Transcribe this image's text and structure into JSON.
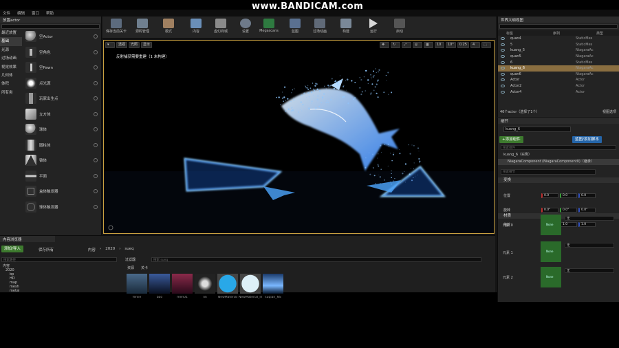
{
  "watermark": "www.BANDICAM.com",
  "menu": [
    "文件",
    "编辑",
    "窗口",
    "帮助"
  ],
  "place_panel": {
    "title": "放置actor",
    "categories": [
      "最近放置",
      "基础",
      "光源",
      "过场动画",
      "视觉效果",
      "几何体",
      "体积",
      "所有类"
    ],
    "selected_category": 1,
    "items": [
      "空Actor",
      "空角色",
      "空Pawn",
      "点光源",
      "玩家出生点",
      "立方体",
      "球体",
      "圆柱体",
      "锥体",
      "平面",
      "盒体触发器",
      "球体触发器"
    ]
  },
  "toolbar": {
    "buttons": [
      "保存当前关卡",
      "源码管理",
      "模式",
      "内容",
      "虚幻商城",
      "设置",
      "Megascans",
      "蓝图",
      "过场动画",
      "构建",
      "运行",
      "启动"
    ]
  },
  "viewport": {
    "left_buttons": [
      "透视",
      "光照",
      "显示"
    ],
    "right_buttons": [
      "10",
      "10°",
      "0.25",
      "4"
    ],
    "notice": "反射捕获需要重建（1 未构建）"
  },
  "outliner": {
    "title": "世界大纲视图",
    "col_label": "标签",
    "col_order": "序列",
    "col_type": "类型",
    "rows": [
      {
        "name": "quan4",
        "type": "StaticMes"
      },
      {
        "name": "5",
        "type": "StaticMes"
      },
      {
        "name": "kuang_5",
        "type": "NiagaraAc"
      },
      {
        "name": "quan5",
        "type": "NiagaraAc"
      },
      {
        "name": "6",
        "type": "StaticMes"
      },
      {
        "name": "kuang_6",
        "type": "NiagaraAc"
      },
      {
        "name": "quan6",
        "type": "NiagaraAc"
      },
      {
        "name": "Actor",
        "type": "Actor"
      },
      {
        "name": "Actor2",
        "type": "Actor"
      },
      {
        "name": "Actor4",
        "type": "Actor"
      }
    ],
    "selected_row": 5,
    "status": "46个actor（选择了1个）",
    "view_options": "视图选项"
  },
  "details": {
    "title": "细节",
    "name_value": "kuang_6",
    "add_component": "+添加组件",
    "blueprint": "蓝图/添加脚本",
    "search_components": "搜索组件",
    "instance_label": "kuang_6（实例）",
    "component_label": "NiagaraComponent (NiagaraComponent0)（继承）",
    "search_details": "搜索细节",
    "transform_section": "变换",
    "location_label": "位置",
    "rotation_label": "旋转",
    "scale_label": "缩放",
    "location": [
      "0.0",
      "0.0",
      "0.0"
    ],
    "rotation": [
      "0.0°",
      "0.0°",
      "0.0°"
    ],
    "scale": [
      "1.0",
      "1.0",
      "1.0"
    ],
    "materials_section": "材质",
    "elements": [
      {
        "label": "元素 0",
        "value": "无"
      },
      {
        "label": "元素 1",
        "value": "无"
      },
      {
        "label": "元素 2",
        "value": "无"
      }
    ],
    "thumb_text": "None"
  },
  "content_browser": {
    "title": "内容浏览器",
    "add_import": "添加/导入",
    "save_all": "保存所有",
    "path": [
      "内容",
      "2020",
      "sueq"
    ],
    "search_folders": "搜索路径",
    "filters": "过滤器",
    "search_assets": "搜索 sueq",
    "col_type": "资源",
    "col_size": "关卡",
    "folders": [
      "内容",
      "2020",
      "bp",
      "HD",
      "map",
      "mesh",
      "metal"
    ],
    "assets": [
      "fenlie",
      "bao",
      "men01",
      "lin",
      "NewMaterial",
      "NewMaterial_Inst",
      "suqian_NS"
    ]
  }
}
